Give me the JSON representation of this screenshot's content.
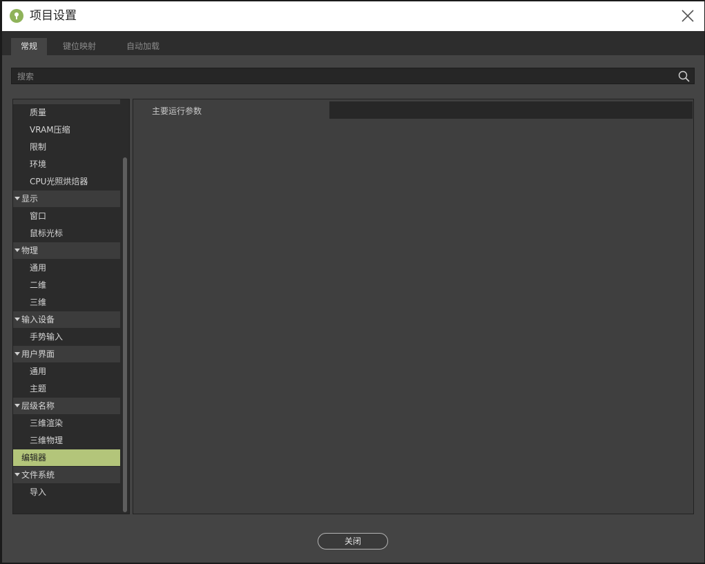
{
  "window": {
    "title": "项目设置"
  },
  "tabs": [
    {
      "label": "常规",
      "active": true
    },
    {
      "label": "键位映射",
      "active": false
    },
    {
      "label": "自动加载",
      "active": false
    }
  ],
  "search": {
    "placeholder": "搜索",
    "value": ""
  },
  "tree": {
    "items": [
      {
        "label": "质量",
        "kind": "child"
      },
      {
        "label": "VRAM压缩",
        "kind": "child"
      },
      {
        "label": "限制",
        "kind": "child"
      },
      {
        "label": "环境",
        "kind": "child"
      },
      {
        "label": "CPU光照烘焙器",
        "kind": "child"
      },
      {
        "label": "显示",
        "kind": "section"
      },
      {
        "label": "窗口",
        "kind": "child"
      },
      {
        "label": "鼠标光标",
        "kind": "child"
      },
      {
        "label": "物理",
        "kind": "section"
      },
      {
        "label": "通用",
        "kind": "child"
      },
      {
        "label": "二维",
        "kind": "child"
      },
      {
        "label": "三维",
        "kind": "child"
      },
      {
        "label": "输入设备",
        "kind": "section"
      },
      {
        "label": "手势输入",
        "kind": "child"
      },
      {
        "label": "用户界面",
        "kind": "section"
      },
      {
        "label": "通用",
        "kind": "child"
      },
      {
        "label": "主题",
        "kind": "child"
      },
      {
        "label": "层级名称",
        "kind": "section"
      },
      {
        "label": "三维渲染",
        "kind": "child"
      },
      {
        "label": "三维物理",
        "kind": "child"
      },
      {
        "label": "编辑器",
        "kind": "selected"
      },
      {
        "label": "文件系统",
        "kind": "section"
      },
      {
        "label": "导入",
        "kind": "child"
      }
    ]
  },
  "property": {
    "label": "主要运行参数",
    "value": ""
  },
  "footer": {
    "close_label": "关闭"
  },
  "colors": {
    "accent_selected": "#b3c57a",
    "panel_bg": "#444444",
    "field_bg": "#272727",
    "tab_bar": "#2d2d2d",
    "icon_green": "#8fb35a"
  },
  "icons": {
    "app": "godot-app-icon",
    "close": "close-icon",
    "search": "search-icon",
    "caret": "caret-down-icon"
  }
}
